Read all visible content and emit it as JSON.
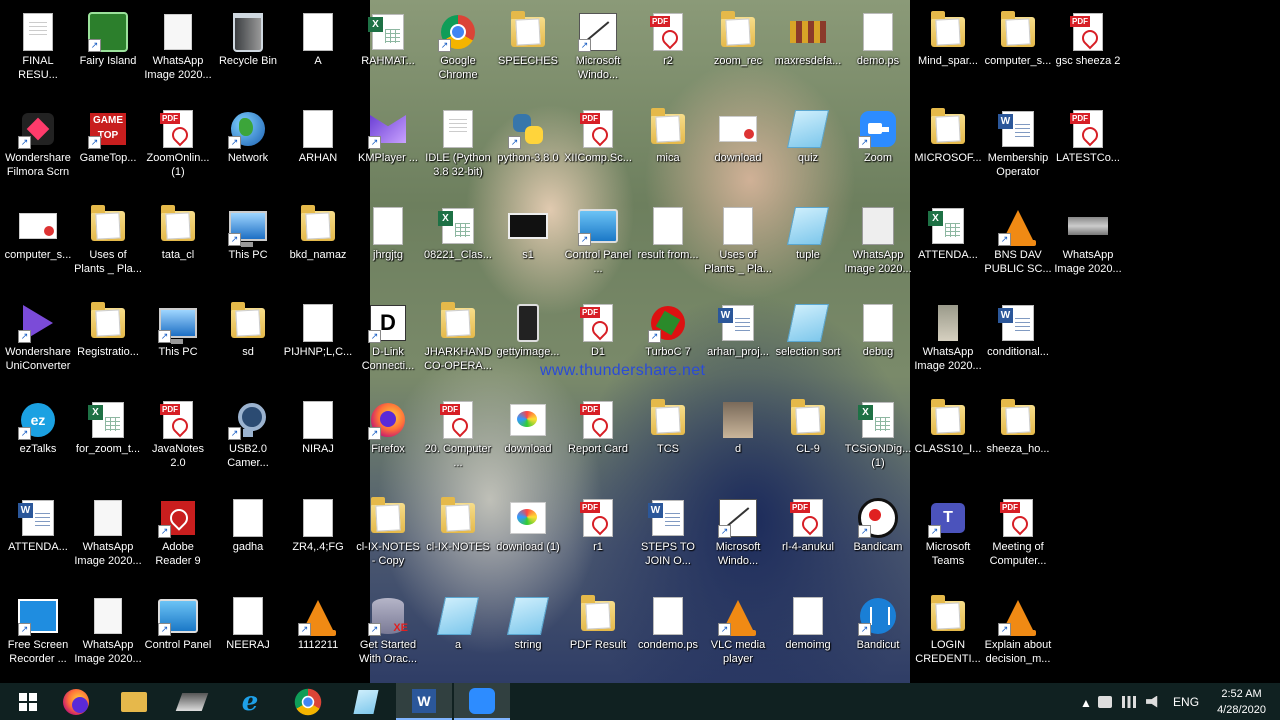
{
  "watermark": "www.thundershare.net",
  "colors": {
    "taskbar": "#14282a",
    "watermark": "#2a4bd6"
  },
  "desktop_icons": [
    {
      "label": "FINAL RESU...",
      "icon": "word-doc-icon",
      "type": "doc"
    },
    {
      "label": "Fairy Island",
      "icon": "fairy-island-icon",
      "type": "fairy"
    },
    {
      "label": "WhatsApp Image 2020...",
      "icon": "image-icon",
      "type": "whatsapp"
    },
    {
      "label": "Recycle Bin",
      "icon": "recycle-bin-icon",
      "type": "bin"
    },
    {
      "label": "A",
      "icon": "file-icon",
      "type": "textfile"
    },
    {
      "label": "RAHMAT...",
      "icon": "excel-icon",
      "type": "excel"
    },
    {
      "label": "Google Chrome",
      "icon": "chrome-icon",
      "type": "chrome"
    },
    {
      "label": "SPEECHES",
      "icon": "folder-icon",
      "type": "folder"
    },
    {
      "label": "Microsoft Windo...",
      "icon": "todoc-icon",
      "type": "todoc"
    },
    {
      "label": "r2",
      "icon": "pdf-icon",
      "type": "pdf"
    },
    {
      "label": "zoom_rec",
      "icon": "folder-icon",
      "type": "folder"
    },
    {
      "label": "maxresdefa...",
      "icon": "image-icon",
      "type": "flag"
    },
    {
      "label": "demo.ps",
      "icon": "file-icon",
      "type": "textfile"
    },
    {
      "label": "Mind_spar...",
      "icon": "folder-icon",
      "type": "folder"
    },
    {
      "label": "computer_s...",
      "icon": "folder-icon",
      "type": "folder"
    },
    {
      "label": "gsc sheeza 2",
      "icon": "pdf-icon",
      "type": "pdf"
    },
    {
      "label": "Wondershare Filmora Scrn",
      "icon": "filmora-icon",
      "type": "wondershare"
    },
    {
      "label": "GameTop...",
      "icon": "gametop-icon",
      "type": "game"
    },
    {
      "label": "ZoomOnlin... (1)",
      "icon": "pdf-icon",
      "type": "pdf"
    },
    {
      "label": "Network",
      "icon": "network-icon",
      "type": "globe"
    },
    {
      "label": "ARHAN",
      "icon": "file-icon",
      "type": "textfile"
    },
    {
      "label": "KMPlayer ...",
      "icon": "kmplayer-icon",
      "type": "kmplayer"
    },
    {
      "label": "IDLE (Python 3.8 32-bit)",
      "icon": "idle-icon",
      "type": "doc"
    },
    {
      "label": "python-3.8.0",
      "icon": "python-icon",
      "type": "python"
    },
    {
      "label": "XIIComp.Sc...",
      "icon": "pdf-icon",
      "type": "pdf"
    },
    {
      "label": "mica",
      "icon": "folder-icon",
      "type": "folder"
    },
    {
      "label": "download",
      "icon": "image-icon",
      "type": "cert-red"
    },
    {
      "label": "quiz",
      "icon": "notepad-icon",
      "type": "notepad"
    },
    {
      "label": "Zoom",
      "icon": "zoom-icon",
      "type": "zoom"
    },
    {
      "label": "MICROSOF...",
      "icon": "folder-icon",
      "type": "folder"
    },
    {
      "label": "Membership Operator",
      "icon": "word-icon",
      "type": "word"
    },
    {
      "label": "LATESTCo...",
      "icon": "pdf-icon",
      "type": "pdf"
    },
    {
      "label": "computer_s...",
      "icon": "image-icon",
      "type": "cert-red"
    },
    {
      "label": "Uses of Plants _ Pla...",
      "icon": "folder-icon",
      "type": "folder"
    },
    {
      "label": "tata_cl",
      "icon": "folder-icon",
      "type": "folder"
    },
    {
      "label": "This PC",
      "icon": "this-pc-icon",
      "type": "pc"
    },
    {
      "label": "bkd_namaz",
      "icon": "folder-icon",
      "type": "folder"
    },
    {
      "label": "jhrgjtg",
      "icon": "file-icon",
      "type": "textfile"
    },
    {
      "label": "08221_Clas...",
      "icon": "excel-icon",
      "type": "excel"
    },
    {
      "label": "s1",
      "icon": "image-icon",
      "type": "s1"
    },
    {
      "label": "Control Panel ...",
      "icon": "control-panel-icon",
      "type": "cpanel"
    },
    {
      "label": "result from...",
      "icon": "file-icon",
      "type": "textfile"
    },
    {
      "label": "Uses of Plants _ Pla...",
      "icon": "file-icon",
      "type": "textfile"
    },
    {
      "label": "tuple",
      "icon": "notepad-icon",
      "type": "notepad"
    },
    {
      "label": "WhatsApp Image 2020...",
      "icon": "image-icon",
      "type": "certificate"
    },
    {
      "label": "ATTENDA...",
      "icon": "excel-icon",
      "type": "excel"
    },
    {
      "label": "BNS DAV PUBLIC SC...",
      "icon": "vlc-icon",
      "type": "vlc"
    },
    {
      "label": "WhatsApp Image 2020...",
      "icon": "image-icon",
      "type": "gray"
    },
    {
      "label": "Wondershare UniConverter",
      "icon": "uniconverter-icon",
      "type": "uniconv"
    },
    {
      "label": "Registratio...",
      "icon": "folder-icon",
      "type": "folder"
    },
    {
      "label": "This PC",
      "icon": "this-pc-icon",
      "type": "pc"
    },
    {
      "label": "sd",
      "icon": "folder-user-icon",
      "type": "folder"
    },
    {
      "label": "PIJHNP;L,C...",
      "icon": "file-icon",
      "type": "textfile"
    },
    {
      "label": "D-Link Connecti...",
      "icon": "dlink-icon",
      "type": "dlink"
    },
    {
      "label": "JHARKHAND CO-OPERA...",
      "icon": "folder-icon",
      "type": "folder"
    },
    {
      "label": "gettyimage...",
      "icon": "image-icon",
      "type": "phone"
    },
    {
      "label": "D1",
      "icon": "pdf-icon",
      "type": "pdf"
    },
    {
      "label": "TurboC 7",
      "icon": "turboc-icon",
      "type": "turboc"
    },
    {
      "label": "arhan_proj...",
      "icon": "word-icon",
      "type": "word"
    },
    {
      "label": "selection sort",
      "icon": "notepad-icon",
      "type": "notepad"
    },
    {
      "label": "debug",
      "icon": "file-icon",
      "type": "textfile"
    },
    {
      "label": "WhatsApp Image 2020...",
      "icon": "image-icon",
      "type": "tall"
    },
    {
      "label": "conditional...",
      "icon": "word-icon",
      "type": "word"
    },
    {
      "label": "ezTalks",
      "icon": "eztalks-icon",
      "type": "ez"
    },
    {
      "label": "for_zoom_t...",
      "icon": "excel-icon",
      "type": "excel"
    },
    {
      "label": "JavaNotes 2.0",
      "icon": "pdf-icon",
      "type": "pdf"
    },
    {
      "label": "USB2.0 Camer...",
      "icon": "camera-icon",
      "type": "camera"
    },
    {
      "label": "NIRAJ",
      "icon": "file-icon",
      "type": "textfile"
    },
    {
      "label": "Firefox",
      "icon": "firefox-icon",
      "type": "firefox"
    },
    {
      "label": "20. Computer ...",
      "icon": "pdf-icon",
      "type": "pdf"
    },
    {
      "label": "download",
      "icon": "paint-icon",
      "type": "paint"
    },
    {
      "label": "Report Card",
      "icon": "pdf-icon",
      "type": "pdf"
    },
    {
      "label": "TCS",
      "icon": "folder-icon",
      "type": "folder"
    },
    {
      "label": "d",
      "icon": "image-icon",
      "type": "photo"
    },
    {
      "label": "CL-9",
      "icon": "folder-icon",
      "type": "folder"
    },
    {
      "label": "TCSiONDig... (1)",
      "icon": "excel-icon",
      "type": "excel"
    },
    {
      "label": "CLASS10_I...",
      "icon": "folder-icon",
      "type": "folder"
    },
    {
      "label": "sheeza_ho...",
      "icon": "folder-icon",
      "type": "folder"
    },
    {
      "label": "ATTENDA...",
      "icon": "word-icon",
      "type": "word"
    },
    {
      "label": "WhatsApp Image 2020...",
      "icon": "image-icon",
      "type": "whatsapp"
    },
    {
      "label": "Adobe Reader 9",
      "icon": "adobe-reader-icon",
      "type": "adobe"
    },
    {
      "label": "gadha",
      "icon": "file-icon",
      "type": "textfile"
    },
    {
      "label": "ZR4,.4;FG",
      "icon": "file-icon",
      "type": "textfile"
    },
    {
      "label": "cl-IX-NOTES - Copy",
      "icon": "folder-icon",
      "type": "folder"
    },
    {
      "label": "cl-IX-NOTES",
      "icon": "folder-icon",
      "type": "folder"
    },
    {
      "label": "download (1)",
      "icon": "paint-icon",
      "type": "paint"
    },
    {
      "label": "r1",
      "icon": "pdf-icon",
      "type": "pdf"
    },
    {
      "label": "STEPS TO JOIN O...",
      "icon": "word-icon",
      "type": "word"
    },
    {
      "label": "Microsoft Windo...",
      "icon": "todoc-icon",
      "type": "todoc"
    },
    {
      "label": "rl-4-anukul",
      "icon": "pdf-icon",
      "type": "pdf"
    },
    {
      "label": "Bandicam",
      "icon": "bandicam-icon",
      "type": "bandicam"
    },
    {
      "label": "Microsoft Teams",
      "icon": "teams-icon",
      "type": "teams"
    },
    {
      "label": "Meeting of Computer...",
      "icon": "pdf-icon",
      "type": "pdf"
    },
    {
      "label": "Free Screen Recorder ...",
      "icon": "screen-recorder-icon",
      "type": "fsr"
    },
    {
      "label": "WhatsApp Image 2020...",
      "icon": "image-icon",
      "type": "whatsapp"
    },
    {
      "label": "Control Panel",
      "icon": "control-panel-icon",
      "type": "cpanel"
    },
    {
      "label": "NEERAJ",
      "icon": "file-icon",
      "type": "textfile"
    },
    {
      "label": "1112211",
      "icon": "vlc-icon",
      "type": "vlc"
    },
    {
      "label": "Get Started With Orac...",
      "icon": "oracle-db-icon",
      "type": "db"
    },
    {
      "label": "a",
      "icon": "notepad-icon",
      "type": "notepad"
    },
    {
      "label": "string",
      "icon": "notepad-icon",
      "type": "notepad"
    },
    {
      "label": "PDF Result",
      "icon": "folder-icon",
      "type": "folder"
    },
    {
      "label": "condemo.ps",
      "icon": "file-icon",
      "type": "textfile"
    },
    {
      "label": "VLC media player",
      "icon": "vlc-icon",
      "type": "vlc"
    },
    {
      "label": "demoimg",
      "icon": "file-icon",
      "type": "textfile"
    },
    {
      "label": "Bandicut",
      "icon": "bandicut-icon",
      "type": "bandicut"
    },
    {
      "label": "LOGIN CREDENTI...",
      "icon": "folder-icon",
      "type": "folder"
    },
    {
      "label": "Explain about decision_m...",
      "icon": "vlc-icon",
      "type": "vlc"
    }
  ],
  "taskbar": {
    "items": [
      {
        "icon": "start-icon"
      },
      {
        "icon": "firefox-icon"
      },
      {
        "icon": "file-explorer-icon"
      },
      {
        "icon": "scanner-icon"
      },
      {
        "icon": "internet-explorer-icon"
      },
      {
        "icon": "chrome-icon"
      },
      {
        "icon": "notepad-icon"
      },
      {
        "icon": "word-icon"
      },
      {
        "icon": "zoom-icon"
      }
    ],
    "language": "ENG",
    "time": "2:52 AM",
    "date": "4/28/2020"
  }
}
